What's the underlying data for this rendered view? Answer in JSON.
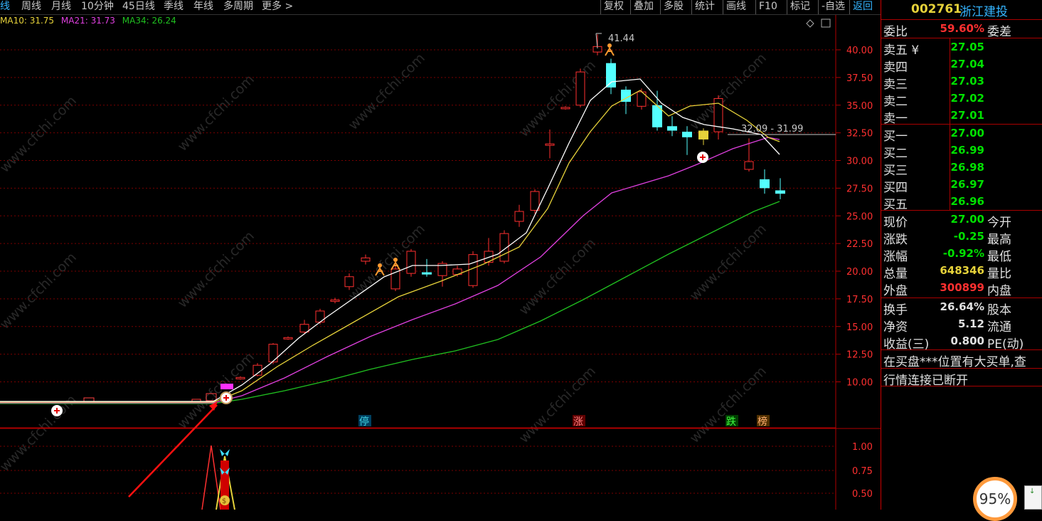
{
  "toolbar": {
    "periods": [
      "线",
      "周线",
      "月线",
      "10分钟",
      "45日线",
      "季线",
      "年线",
      "多周期",
      "更多 >"
    ],
    "tools": [
      "复权",
      "叠加",
      "多股",
      "统计",
      "画线",
      "F10",
      "标记",
      "-自选",
      "返回"
    ]
  },
  "ma": {
    "ma10": "MA10: 31.75",
    "ma21": "MA21: 31.73",
    "ma34": "MA34: 26.24",
    "colors": {
      "ma5": "#ffffff",
      "ma10": "#e6d23a",
      "ma21": "#e040e0",
      "ma34": "#20c020"
    }
  },
  "chart": {
    "price_ticks": [
      "40.00",
      "37.50",
      "35.00",
      "32.50",
      "30.00",
      "27.50",
      "25.00",
      "22.50",
      "20.00",
      "17.50",
      "15.00",
      "12.50",
      "10.00"
    ],
    "indicator_ticks": [
      "1.00",
      "0.75",
      "0.50"
    ],
    "high_label": "41.44",
    "range_label": "32.09 - 31.99",
    "markers": [
      "停",
      "涨",
      "跌",
      "榜"
    ],
    "watermark": "www.cfchi.com"
  },
  "quote": {
    "code": "002761",
    "name": "浙江建投",
    "webi_label": "委比",
    "webi_value": "59.60%",
    "weicha_label": "委差",
    "sells": [
      {
        "label": "卖五",
        "price": "27.05"
      },
      {
        "label": "卖四",
        "price": "27.04"
      },
      {
        "label": "卖三",
        "price": "27.03"
      },
      {
        "label": "卖二",
        "price": "27.02"
      },
      {
        "label": "卖一",
        "price": "27.01"
      }
    ],
    "buys": [
      {
        "label": "买一",
        "price": "27.00"
      },
      {
        "label": "买二",
        "price": "26.99"
      },
      {
        "label": "买三",
        "price": "26.98"
      },
      {
        "label": "买四",
        "price": "26.97"
      },
      {
        "label": "买五",
        "price": "26.96"
      }
    ],
    "stats": [
      {
        "label": "现价",
        "value": "27.00",
        "label2": "今开",
        "color": "#00e000"
      },
      {
        "label": "涨跌",
        "value": "-0.25",
        "label2": "最高",
        "color": "#00e000"
      },
      {
        "label": "涨幅",
        "value": "-0.92%",
        "label2": "最低",
        "color": "#00e000"
      },
      {
        "label": "总量",
        "value": "648346",
        "label2": "量比",
        "color": "#e6d23a"
      },
      {
        "label": "外盘",
        "value": "300899",
        "label2": "内盘",
        "color": "#ff3030"
      }
    ],
    "stats2": [
      {
        "label": "换手",
        "value": "26.64%",
        "label2": "股本"
      },
      {
        "label": "净资",
        "value": "5.12",
        "label2": "流通"
      },
      {
        "label": "收益(三)",
        "value": "0.800",
        "label2": "PE(动)"
      }
    ],
    "message1": "在买盘***位置有大买单,查",
    "message2": "行情连接已断开"
  },
  "overlay": {
    "percent": "95%"
  }
}
